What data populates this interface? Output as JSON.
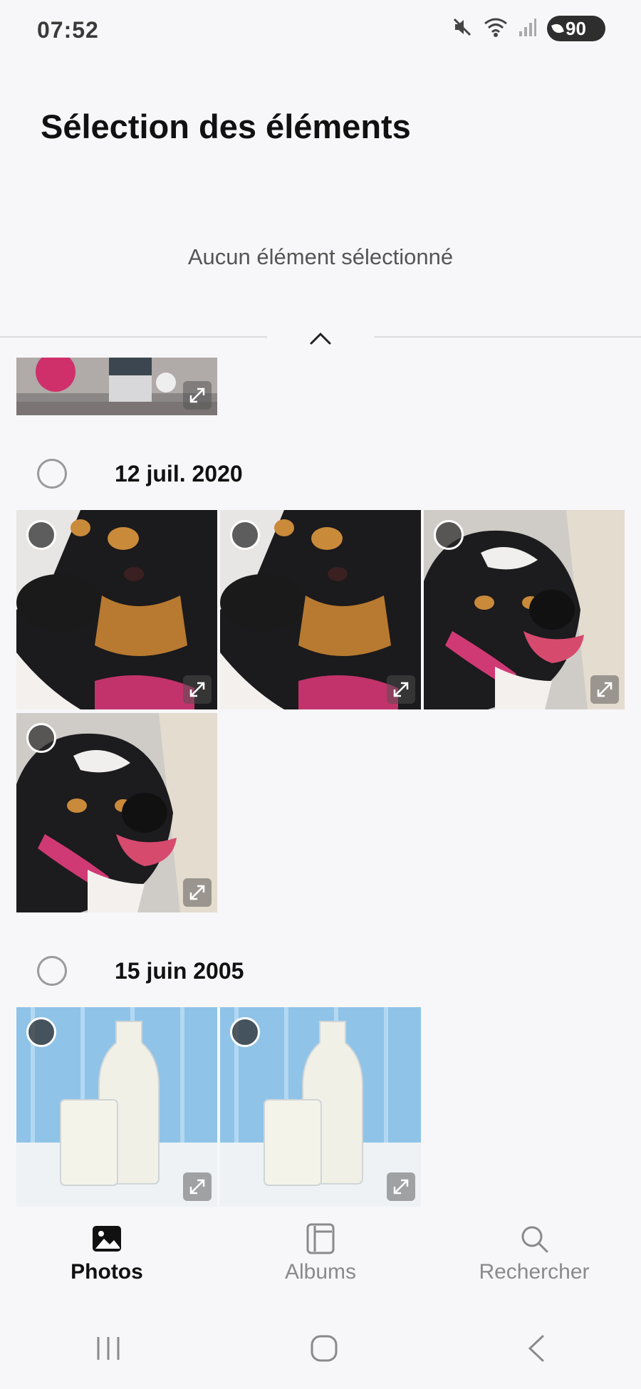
{
  "status_bar": {
    "time": "07:52",
    "battery": "90",
    "icons": [
      "mute-icon",
      "wifi-icon",
      "signal-icon"
    ]
  },
  "header": {
    "title": "Sélection des éléments",
    "selection_status": "Aucun élément sélectionné"
  },
  "groups": [
    {
      "date": "12 juil. 2020",
      "photo_count": 4
    },
    {
      "date": "15 juin 2005",
      "photo_count": 2
    }
  ],
  "bottom_nav": {
    "items": [
      {
        "label": "Photos",
        "icon": "photos-icon",
        "active": true
      },
      {
        "label": "Albums",
        "icon": "albums-icon",
        "active": false
      },
      {
        "label": "Rechercher",
        "icon": "search-icon",
        "active": false
      }
    ]
  },
  "system_nav": [
    "recents-icon",
    "home-icon",
    "back-icon"
  ],
  "colors": {
    "background": "#f7f7f9",
    "active_text": "#111111",
    "inactive_text": "#8a8a8a"
  }
}
